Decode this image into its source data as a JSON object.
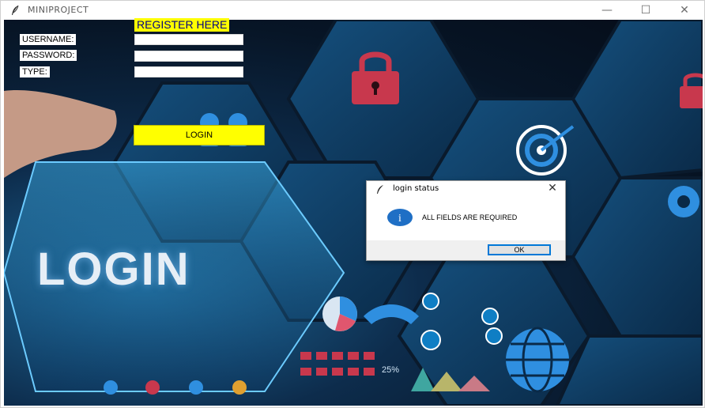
{
  "window": {
    "title": "MINIPROJECT",
    "minimize_glyph": "—",
    "maximize_glyph": "☐",
    "close_glyph": "✕",
    "icon": "feather-icon"
  },
  "form": {
    "register_label": "REGISTER HERE",
    "username_label": "USERNAME:",
    "password_label": "PASSWORD:",
    "type_label": "TYPE:",
    "username_value": "",
    "password_value": "",
    "type_value": "",
    "login_button": "LOGIN"
  },
  "background": {
    "hero_text": "LOGIN",
    "stat_text": "25%",
    "colors": {
      "hex_fill": "#0e3b63",
      "hex_edge": "#0a1a2c",
      "lock": "#c8384d",
      "accent_blue": "#2f8fe0"
    },
    "icons": [
      "lock-icon",
      "target-icon",
      "globe-icon",
      "handshake-icon",
      "gear-icon",
      "pie-chart-icon",
      "users-icon"
    ]
  },
  "dialog": {
    "title": "login status",
    "message": "ALL FIELDS ARE REQUIRED",
    "ok_label": "OK",
    "close_glyph": "✕",
    "icon": "info-icon",
    "info_glyph": "i"
  },
  "accents": {
    "button_yellow": "#ffff00",
    "register_text": "#000080",
    "focus_blue": "#0078d7"
  }
}
